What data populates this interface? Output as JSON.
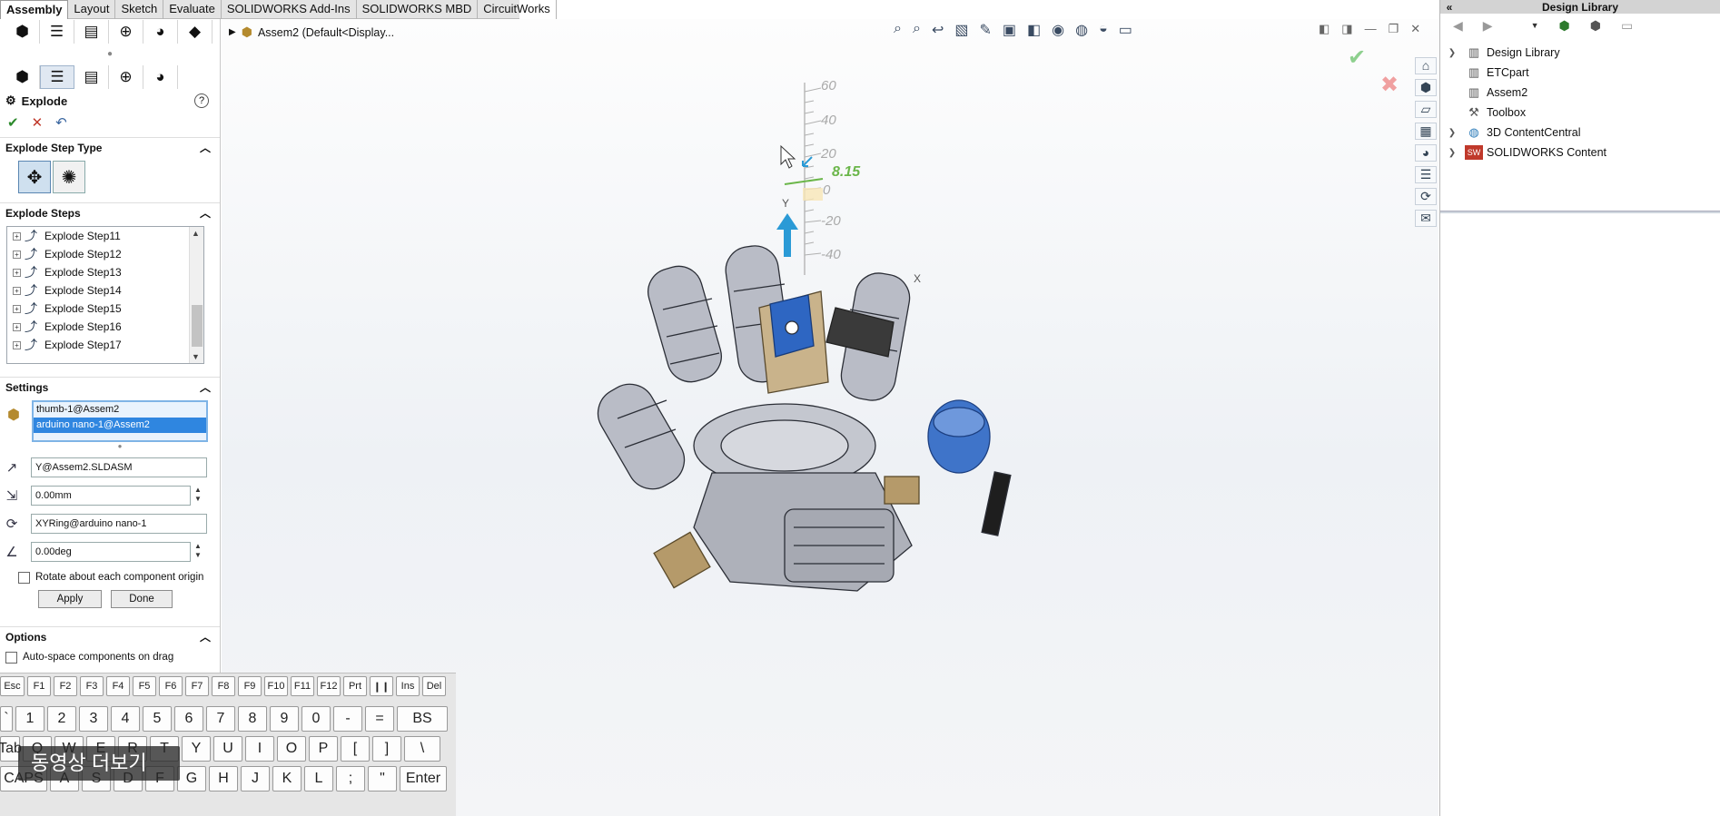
{
  "tabs": [
    "Assembly",
    "Layout",
    "Sketch",
    "Evaluate",
    "SOLIDWORKS Add-Ins",
    "SOLIDWORKS MBD",
    "CircuitWorks"
  ],
  "property_manager": {
    "title": "Explode",
    "help": "?",
    "explode_step_type": {
      "header": "Explode Step Type"
    },
    "explode_steps": {
      "header": "Explode Steps",
      "items": [
        "Explode Step11",
        "Explode Step12",
        "Explode Step13",
        "Explode Step14",
        "Explode Step15",
        "Explode Step16",
        "Explode Step17"
      ]
    },
    "settings": {
      "header": "Settings",
      "components": [
        "thumb-1@Assem2",
        "arduino nano-1@Assem2"
      ],
      "direction": "Y@Assem2.SLDASM",
      "distance": "0.00mm",
      "rotation_axis": "XYRing@arduino nano-1",
      "angle": "0.00deg",
      "rotate_each_label": "Rotate about each component origin",
      "apply": "Apply",
      "done": "Done"
    },
    "options": {
      "header": "Options",
      "auto_space": "Auto-space components on drag"
    }
  },
  "viewport": {
    "feature_tree_root": "Assem2  (Default<Display...",
    "ruler_labels": [
      "60",
      "40",
      "20",
      "0",
      "-20",
      "-40"
    ],
    "ruler_value": "8.15",
    "y_axis_label": "Y",
    "x_axis_label": "X"
  },
  "design_library": {
    "title": "Design Library",
    "collapse": "«",
    "items": [
      {
        "label": "Design Library",
        "expandable": true
      },
      {
        "label": "ETCpart",
        "expandable": false
      },
      {
        "label": "Assem2",
        "expandable": false
      },
      {
        "label": "Toolbox",
        "expandable": false
      },
      {
        "label": "3D ContentCentral",
        "expandable": true
      },
      {
        "label": "SOLIDWORKS Content",
        "expandable": true
      }
    ]
  },
  "keyboard": {
    "row1": [
      "Esc",
      "F1",
      "F2",
      "F3",
      "F4",
      "F5",
      "F6",
      "F7",
      "F8",
      "F9",
      "F10",
      "F11",
      "F12",
      "Prt",
      "❙❙",
      "Ins",
      "Del"
    ],
    "row2": [
      "`",
      "1",
      "2",
      "3",
      "4",
      "5",
      "6",
      "7",
      "8",
      "9",
      "0",
      "-",
      "=",
      "BS"
    ],
    "row3": [
      "Tab",
      "Q",
      "W",
      "E",
      "R",
      "T",
      "Y",
      "U",
      "I",
      "O",
      "P",
      "[",
      "]",
      "\\"
    ],
    "row4": [
      "CAPS",
      "A",
      "S",
      "D",
      "F",
      "G",
      "H",
      "J",
      "K",
      "L",
      ";",
      "\"",
      "Enter"
    ]
  },
  "video_overlay": "동영상 더보기",
  "colors": {
    "accent_blue": "#2f86e0",
    "arrow_blue": "#2a9ad6",
    "ruler_green": "#6bb64a"
  }
}
